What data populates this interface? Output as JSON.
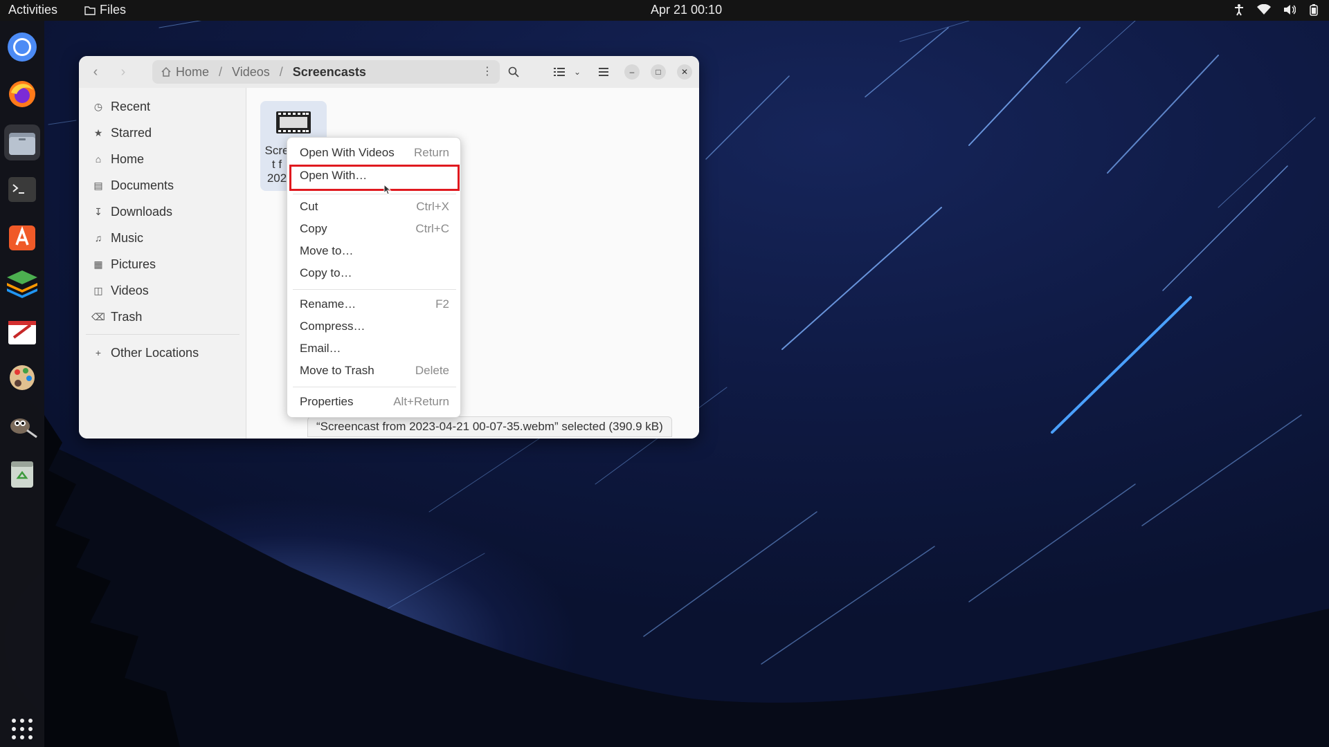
{
  "topbar": {
    "activities": "Activities",
    "app_name": "Files",
    "clock": "Apr 21  00:10"
  },
  "dock": {
    "items": [
      "chromium-icon",
      "firefox-icon",
      "files-icon",
      "terminal-icon",
      "app-center-icon",
      "stacked-layers-icon",
      "text-editor-icon",
      "paint-palette-icon",
      "gimp-icon",
      "trash-icon"
    ],
    "show_apps_icon": "grid-icon"
  },
  "window": {
    "path": {
      "home": "Home",
      "videos": "Videos",
      "current": "Screencasts"
    },
    "sidebar": {
      "items": [
        {
          "label": "Recent",
          "icon": "clock-icon"
        },
        {
          "label": "Starred",
          "icon": "star-icon"
        },
        {
          "label": "Home",
          "icon": "home-icon"
        },
        {
          "label": "Documents",
          "icon": "document-icon"
        },
        {
          "label": "Downloads",
          "icon": "download-icon"
        },
        {
          "label": "Music",
          "icon": "music-icon"
        },
        {
          "label": "Pictures",
          "icon": "picture-icon"
        },
        {
          "label": "Videos",
          "icon": "video-icon"
        },
        {
          "label": "Trash",
          "icon": "trash-icon"
        }
      ],
      "other_locations": "Other Locations"
    },
    "file": {
      "label_lines": [
        "Scre",
        "t f",
        "202"
      ]
    },
    "status": "“Screencast from 2023-04-21 00-07-35.webm” selected  (390.9 kB)"
  },
  "context_menu": {
    "items": [
      {
        "label": "Open With Videos",
        "accel": "Return"
      },
      {
        "label": "Open With…",
        "accel": ""
      },
      {
        "label": "Cut",
        "accel": "Ctrl+X"
      },
      {
        "label": "Copy",
        "accel": "Ctrl+C"
      },
      {
        "label": "Move to…",
        "accel": ""
      },
      {
        "label": "Copy to…",
        "accel": ""
      },
      {
        "label": "Rename…",
        "accel": "F2"
      },
      {
        "label": "Compress…",
        "accel": ""
      },
      {
        "label": "Email…",
        "accel": ""
      },
      {
        "label": "Move to Trash",
        "accel": "Delete"
      },
      {
        "label": "Properties",
        "accel": "Alt+Return"
      }
    ],
    "highlight_color": "#e0191f"
  }
}
